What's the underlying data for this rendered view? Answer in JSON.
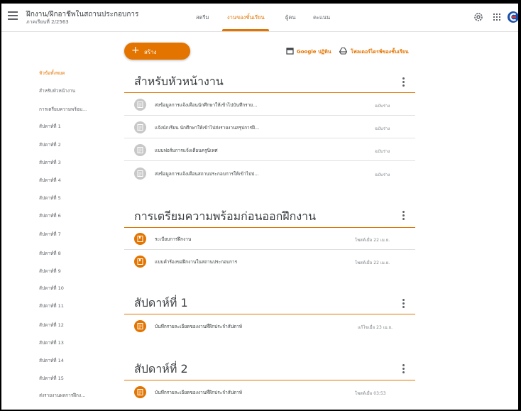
{
  "header": {
    "title": "ฝึกงาน/ฝึกอาชีพในสถานประกอบการ",
    "subtitle": "ภาคเรียนที่ 2/2563",
    "tabs": [
      {
        "label": "สตรีม",
        "active": false
      },
      {
        "label": "งานของชั้นเรียน",
        "active": true
      },
      {
        "label": "ผู้คน",
        "active": false
      },
      {
        "label": "คะแนน",
        "active": false
      }
    ],
    "icons": [
      "settings-icon",
      "apps-grid-icon",
      "account-logo-icon"
    ]
  },
  "toolbar": {
    "create_label": "สร้าง",
    "calendar_label": "Google ปฏิทิน",
    "drive_label": "โฟลเดอร์ไดรฟ์ของชั้นเรียน"
  },
  "sidebar": {
    "items": [
      {
        "label": "หัวข้อทั้งหมด",
        "active": true
      },
      {
        "label": "สำหรับหัวหน้างาน",
        "active": false
      },
      {
        "label": "การเตรียมความพร้อม...",
        "active": false
      },
      {
        "label": "สัปดาห์ที่ 1",
        "active": false
      },
      {
        "label": "สัปดาห์ที่ 2",
        "active": false
      },
      {
        "label": "สัปดาห์ที่ 3",
        "active": false
      },
      {
        "label": "สัปดาห์ที่ 4",
        "active": false
      },
      {
        "label": "สัปดาห์ที่ 5",
        "active": false
      },
      {
        "label": "สัปดาห์ที่ 6",
        "active": false
      },
      {
        "label": "สัปดาห์ที่ 7",
        "active": false
      },
      {
        "label": "สัปดาห์ที่ 8",
        "active": false
      },
      {
        "label": "สัปดาห์ที่ 9",
        "active": false
      },
      {
        "label": "สัปดาห์ที่ 10",
        "active": false
      },
      {
        "label": "สัปดาห์ที่ 11",
        "active": false
      },
      {
        "label": "สัปดาห์ที่ 12",
        "active": false
      },
      {
        "label": "สัปดาห์ที่ 13",
        "active": false
      },
      {
        "label": "สัปดาห์ที่ 14",
        "active": false
      },
      {
        "label": "สัปดาห์ที่ 15",
        "active": false
      },
      {
        "label": "ส่งรายงานผลการฝึกง...",
        "active": false
      }
    ]
  },
  "sections": [
    {
      "title": "สำหรับหัวหน้างาน",
      "items": [
        {
          "title": "ส่งข้อมูลการแจ้งเตือนนักศึกษาให้เข้าไปบันทึกราย...",
          "meta": "ฉบับร่าง",
          "icon": "assignment-icon",
          "style": "gray"
        },
        {
          "title": "แจ้งนักเรียน นักศึกษาให้เข้าไปส่งรายงานสรุปการฝึ...",
          "meta": "ฉบับร่าง",
          "icon": "assignment-icon",
          "style": "gray"
        },
        {
          "title": "แบบฟอร์มการแจ้งเตือนครูนิเทศ",
          "meta": "ฉบับร่าง",
          "icon": "assignment-icon",
          "style": "gray"
        },
        {
          "title": "ส่งข้อมูลการแจ้งเตือนสถานประกอบการให้เข้าไปป...",
          "meta": "ฉบับร่าง",
          "icon": "assignment-icon",
          "style": "gray"
        }
      ]
    },
    {
      "title": "การเตรียมความพร้อมก่อนออกฝึกงาน",
      "items": [
        {
          "title": "ระเบียบการฝึกงาน",
          "meta": "โพสต์เมื่อ 22 เม.ย.",
          "icon": "material-icon",
          "style": "orange"
        },
        {
          "title": "แบบคำร้องขอฝึกงานในสถานประกอบการ",
          "meta": "โพสต์เมื่อ 22 เม.ย.",
          "icon": "material-icon",
          "style": "orange"
        }
      ]
    },
    {
      "title": "สัปดาห์ที่ 1",
      "items": [
        {
          "title": "บันทึกรายละเอียดของงานที่ฝึกประจำสัปดาห์",
          "meta": "แก้ไขเมื่อ 23 เม.ย.",
          "icon": "assignment-icon",
          "style": "orange"
        }
      ]
    },
    {
      "title": "สัปดาห์ที่ 2",
      "items": [
        {
          "title": "บันทึกรายละเอียดของงานที่ฝึกประจำสัปดาห์",
          "meta": "โพสต์เมื่อ 03:53",
          "icon": "assignment-icon",
          "style": "orange"
        }
      ]
    }
  ],
  "colors": {
    "accent": "#e37400",
    "draft_icon": "#c8c8c8",
    "text": "#3c4043",
    "muted": "#80868b"
  }
}
